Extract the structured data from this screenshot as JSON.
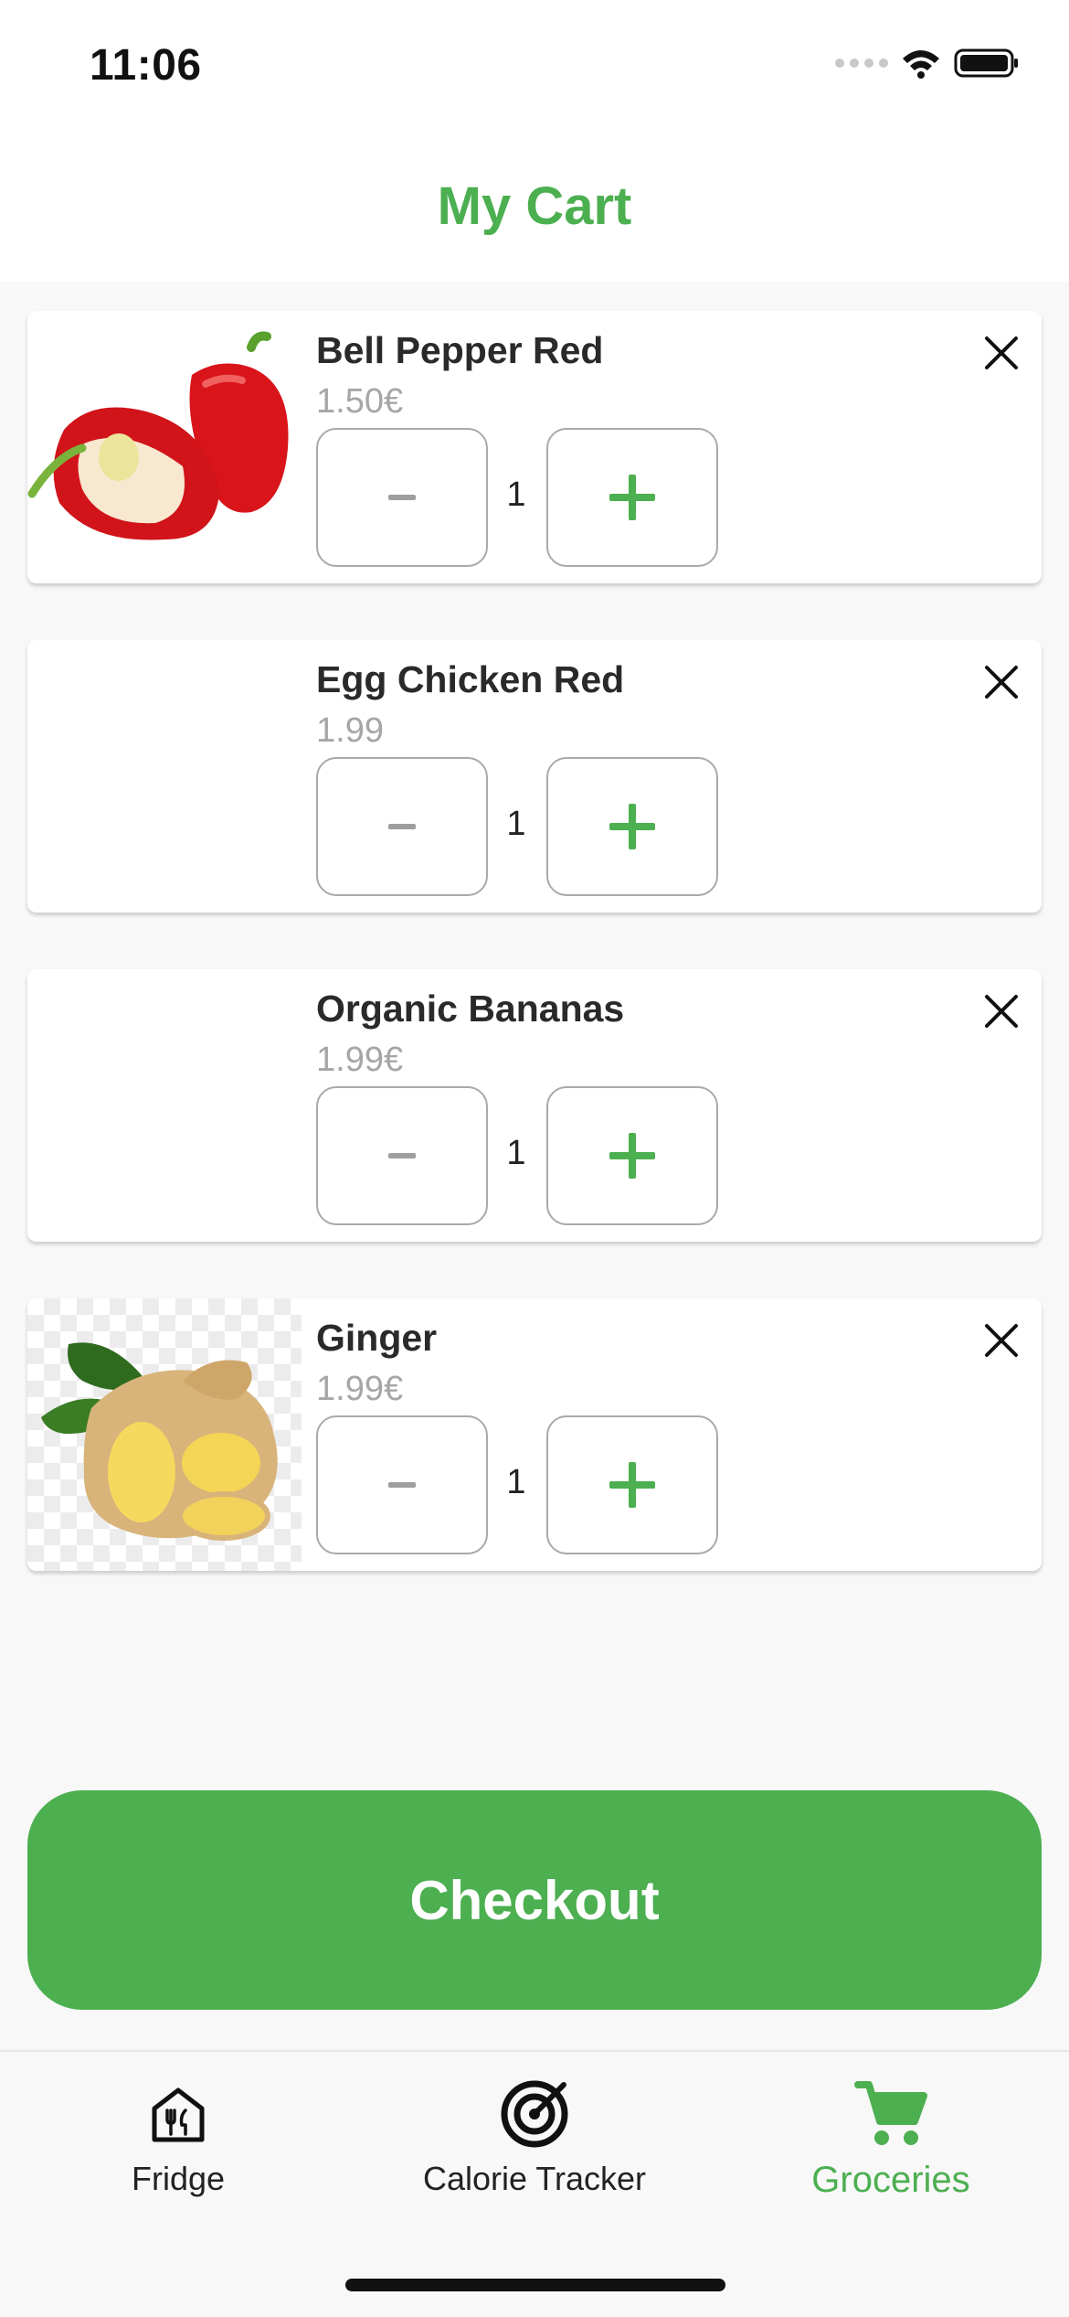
{
  "status_bar": {
    "time": "11:06"
  },
  "header": {
    "title": "My Cart"
  },
  "cart": {
    "items": [
      {
        "name": "Bell Pepper Red",
        "price": "1.50€",
        "quantity": "1",
        "image": "bell-pepper"
      },
      {
        "name": "Egg Chicken Red",
        "price": "1.99",
        "quantity": "1",
        "image": "none"
      },
      {
        "name": "Organic Bananas",
        "price": "1.99€",
        "quantity": "1",
        "image": "none"
      },
      {
        "name": "Ginger",
        "price": "1.99€",
        "quantity": "1",
        "image": "ginger"
      }
    ]
  },
  "checkout_label": "Checkout",
  "tabbar": {
    "tabs": [
      {
        "label": "Fridge",
        "icon": "fridge-house-icon",
        "active": false
      },
      {
        "label": "Calorie Tracker",
        "icon": "target-icon",
        "active": false
      },
      {
        "label": "Groceries",
        "icon": "cart-icon",
        "active": true
      }
    ]
  },
  "colors": {
    "accent": "#4caf50",
    "price": "#a6a6a6",
    "border": "#a9a9a9"
  }
}
